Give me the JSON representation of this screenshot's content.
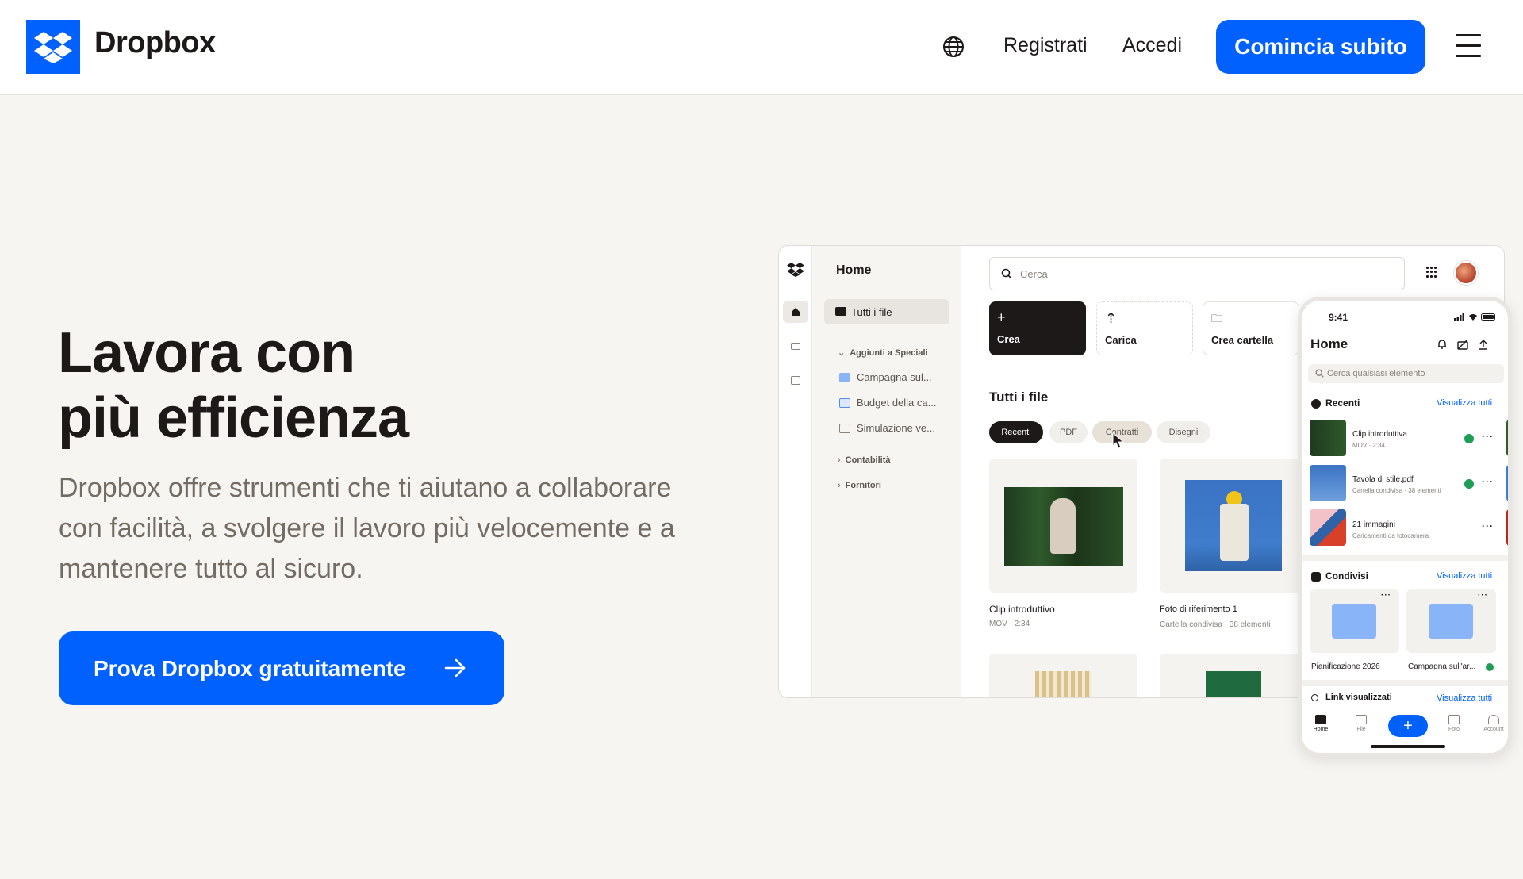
{
  "header": {
    "brand": "Dropbox",
    "nav_register": "Registrati",
    "nav_login": "Accedi",
    "cta": "Comincia subito",
    "globe_icon": "globe-icon",
    "menu_icon": "menu-icon"
  },
  "hero": {
    "title_line1": "Lavora con",
    "title_line2": "più efficienza",
    "subtitle": "Dropbox offre strumenti che ti aiutano a collaborare con facilità, a svolgere il lavoro più velocemente e a mantenere tutto al sicuro.",
    "cta": "Prova Dropbox gratuitamente"
  },
  "app": {
    "sidebar_title": "Home",
    "all_files": "Tutti i file",
    "section_starred": "Aggiunti a Speciali",
    "starred_items": [
      "Campagna sul...",
      "Budget della ca...",
      "Simulazione ve..."
    ],
    "section_accounting": "Contabilità",
    "section_suppliers": "Fornitori",
    "search_placeholder": "Cerca",
    "actions": {
      "create": "Crea",
      "upload": "Carica",
      "new_folder": "Crea cartella"
    },
    "files_title": "Tutti i file",
    "filters": [
      "Recenti",
      "PDF",
      "Contratti",
      "Disegni"
    ],
    "active_filter": "Recenti",
    "files": [
      {
        "name": "Clip introduttivo",
        "meta": "MOV · 2:34"
      },
      {
        "name": "Foto di riferimento 1",
        "meta": "Cartella condivisa · 38 elementi"
      }
    ]
  },
  "phone": {
    "time": "9:41",
    "title": "Home",
    "search_placeholder": "Cerca qualsiasi elemento",
    "recent_title": "Recenti",
    "view_all": "Visualizza tutti",
    "recent_items": [
      {
        "name": "Clip introduttiva",
        "meta": "MOV · 2:34"
      },
      {
        "name": "Tavola di stile.pdf",
        "meta": "Cartella condivisa · 38 elementi"
      },
      {
        "name": "21 immagini",
        "meta": "Caricamenti da fotocamera"
      }
    ],
    "shared_title": "Condivisi",
    "shared_items": [
      "Pianificazione 2026",
      "Campagna sull'ar..."
    ],
    "links_title": "Link visualizzati",
    "tabs": [
      "Home",
      "File",
      "Foto",
      "Account"
    ]
  },
  "colors": {
    "brand_blue": "#0061fe",
    "page_bg": "#f7f5f2",
    "text_dark": "#1e1919",
    "text_muted": "#736c64"
  }
}
